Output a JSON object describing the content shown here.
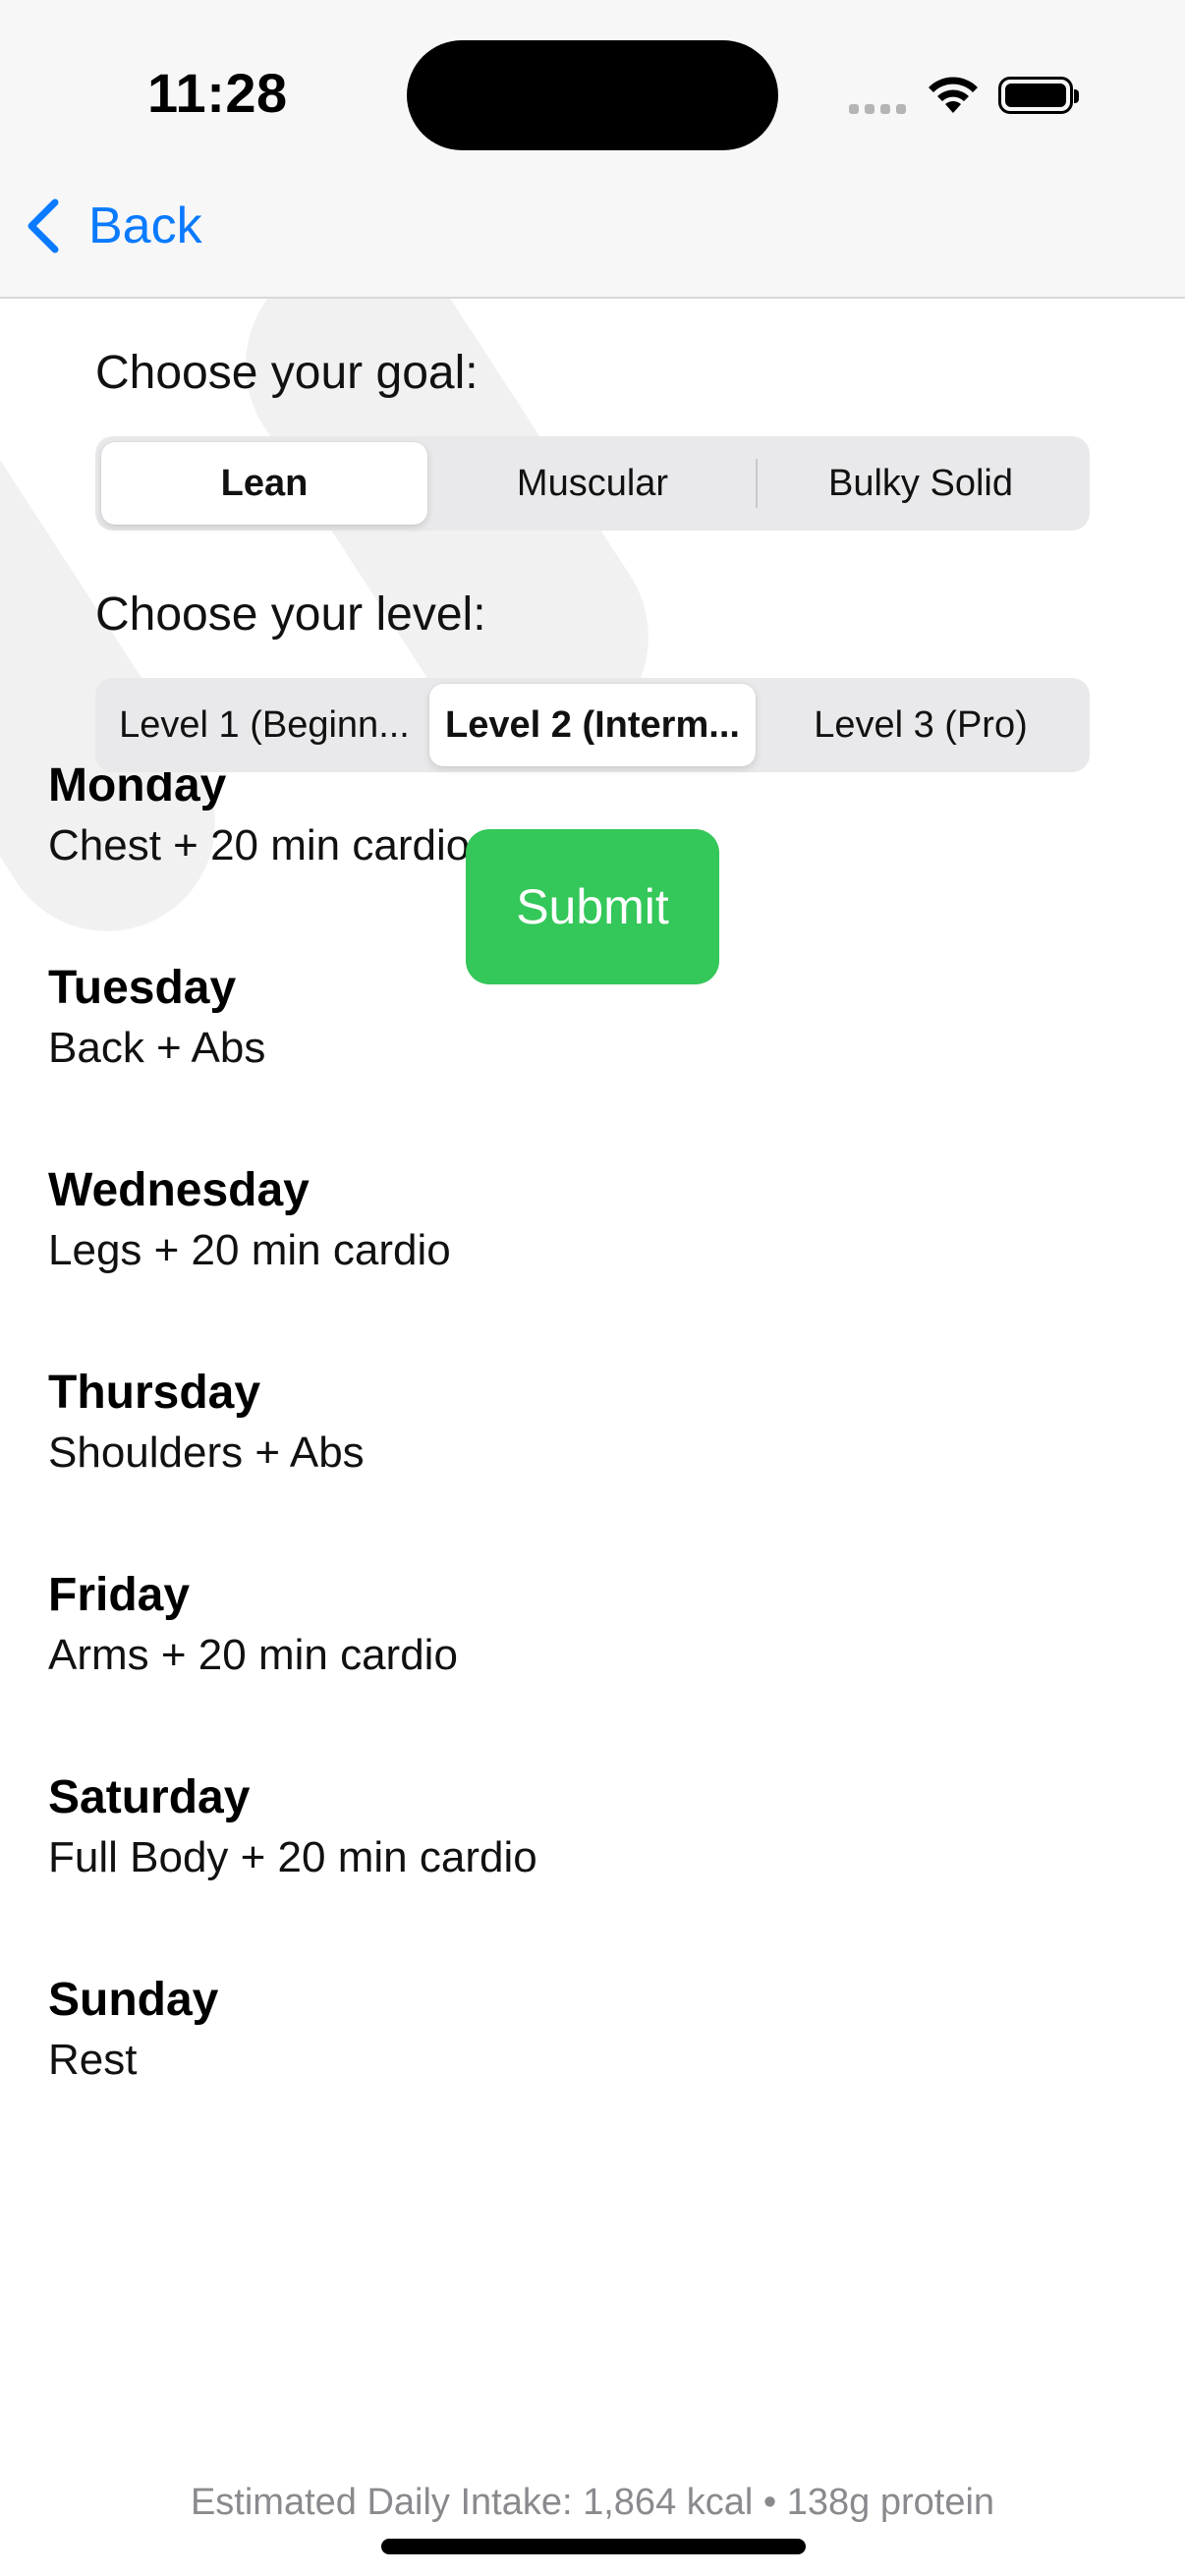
{
  "status_bar": {
    "time": "11:28"
  },
  "nav": {
    "back_label": "Back",
    "accent_color": "#0a7aff"
  },
  "goal": {
    "label": "Choose your goal:",
    "options": [
      "Lean",
      "Muscular",
      "Bulky Solid"
    ],
    "selected": "Lean"
  },
  "level": {
    "label": "Choose your level:",
    "options": [
      "Level 1 (Beginn...",
      "Level 2 (Interm...",
      "Level 3 (Pro)"
    ],
    "selected": "Level 2 (Interm..."
  },
  "submit": {
    "label": "Submit",
    "color": "#34c759"
  },
  "schedule": [
    {
      "day": "Monday",
      "plan": "Chest + 20 min cardio"
    },
    {
      "day": "Tuesday",
      "plan": "Back + Abs"
    },
    {
      "day": "Wednesday",
      "plan": "Legs + 20 min cardio"
    },
    {
      "day": "Thursday",
      "plan": "Shoulders + Abs"
    },
    {
      "day": "Friday",
      "plan": "Arms + 20 min cardio"
    },
    {
      "day": "Saturday",
      "plan": "Full Body + 20 min cardio"
    },
    {
      "day": "Sunday",
      "plan": "Rest"
    }
  ],
  "footer": {
    "text": "Estimated Daily Intake: 1,864 kcal • 138g protein"
  }
}
